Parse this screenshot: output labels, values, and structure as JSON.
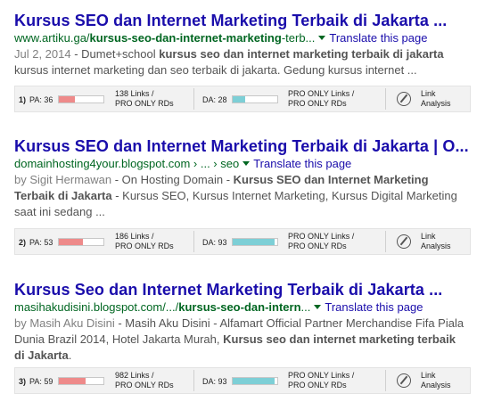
{
  "translate_label": "Translate this page",
  "results": [
    {
      "title": "Kursus SEO dan Internet Marketing Terbaik di Jakarta ...",
      "url_plain": "www.artiku.ga/",
      "url_bold": "kursus-seo-dan-internet-marketing",
      "url_tail": "-terb...",
      "date": "Jul 2, 2014",
      "snippet_pre": " - Dumet+school ",
      "snippet_bold": "kursus seo dan internet marketing terbaik di jakarta",
      "snippet_post": " kursus internet marketing dan seo terbaik di jakarta. Gedung kursus internet ...",
      "seo": {
        "index": "1)",
        "pa_label": "PA: 36",
        "pa_value": 36,
        "pa_links_1": "138 Links /",
        "pa_links_2": "PRO ONLY RDs",
        "da_label": "DA: 28",
        "da_value": 28,
        "da_links_1": "PRO ONLY Links /",
        "da_links_2": "PRO ONLY RDs",
        "la_1": "Link",
        "la_2": "Analysis"
      }
    },
    {
      "title": "Kursus SEO dan Internet Marketing Terbaik di Jakarta | O...",
      "url_plain": "domainhosting4your.blogspot.com",
      "url_tail": " › ... › seo",
      "author": "by Sigit Hermawan",
      "snippet_pre": " - On Hosting Domain - ",
      "snippet_bold": "Kursus SEO dan Internet Marketing Terbaik di Jakarta",
      "snippet_post": " - Kursus SEO, Kursus Internet Marketing, Kursus Digital Marketing saat ini sedang ...",
      "seo": {
        "index": "2)",
        "pa_label": "PA: 53",
        "pa_value": 53,
        "pa_links_1": "186 Links /",
        "pa_links_2": "PRO ONLY RDs",
        "da_label": "DA: 93",
        "da_value": 93,
        "da_links_1": "PRO ONLY Links /",
        "da_links_2": "PRO ONLY RDs",
        "la_1": "Link",
        "la_2": "Analysis"
      }
    },
    {
      "title": "Kursus Seo dan Internet Marketing Terbaik di Jakarta ...",
      "url_plain": "masihakudisini.blogspot.com/.../",
      "url_bold": "kursus-seo-dan-intern",
      "url_tail": "...",
      "author": "by Masih Aku Disini",
      "snippet_pre": " - Masih Aku Disini - Alfamart Official Partner Merchandise Fifa Piala Dunia Brazil 2014, Hotel Jakarta Murah, ",
      "snippet_bold": "Kursus seo dan internet marketing terbaik di Jakarta",
      "snippet_post": ".",
      "seo": {
        "index": "3)",
        "pa_label": "PA: 59",
        "pa_value": 59,
        "pa_links_1": "982 Links /",
        "pa_links_2": "PRO ONLY RDs",
        "da_label": "DA: 93",
        "da_value": 93,
        "da_links_1": "PRO ONLY Links /",
        "da_links_2": "PRO ONLY RDs",
        "la_1": "Link",
        "la_2": "Analysis"
      }
    }
  ]
}
